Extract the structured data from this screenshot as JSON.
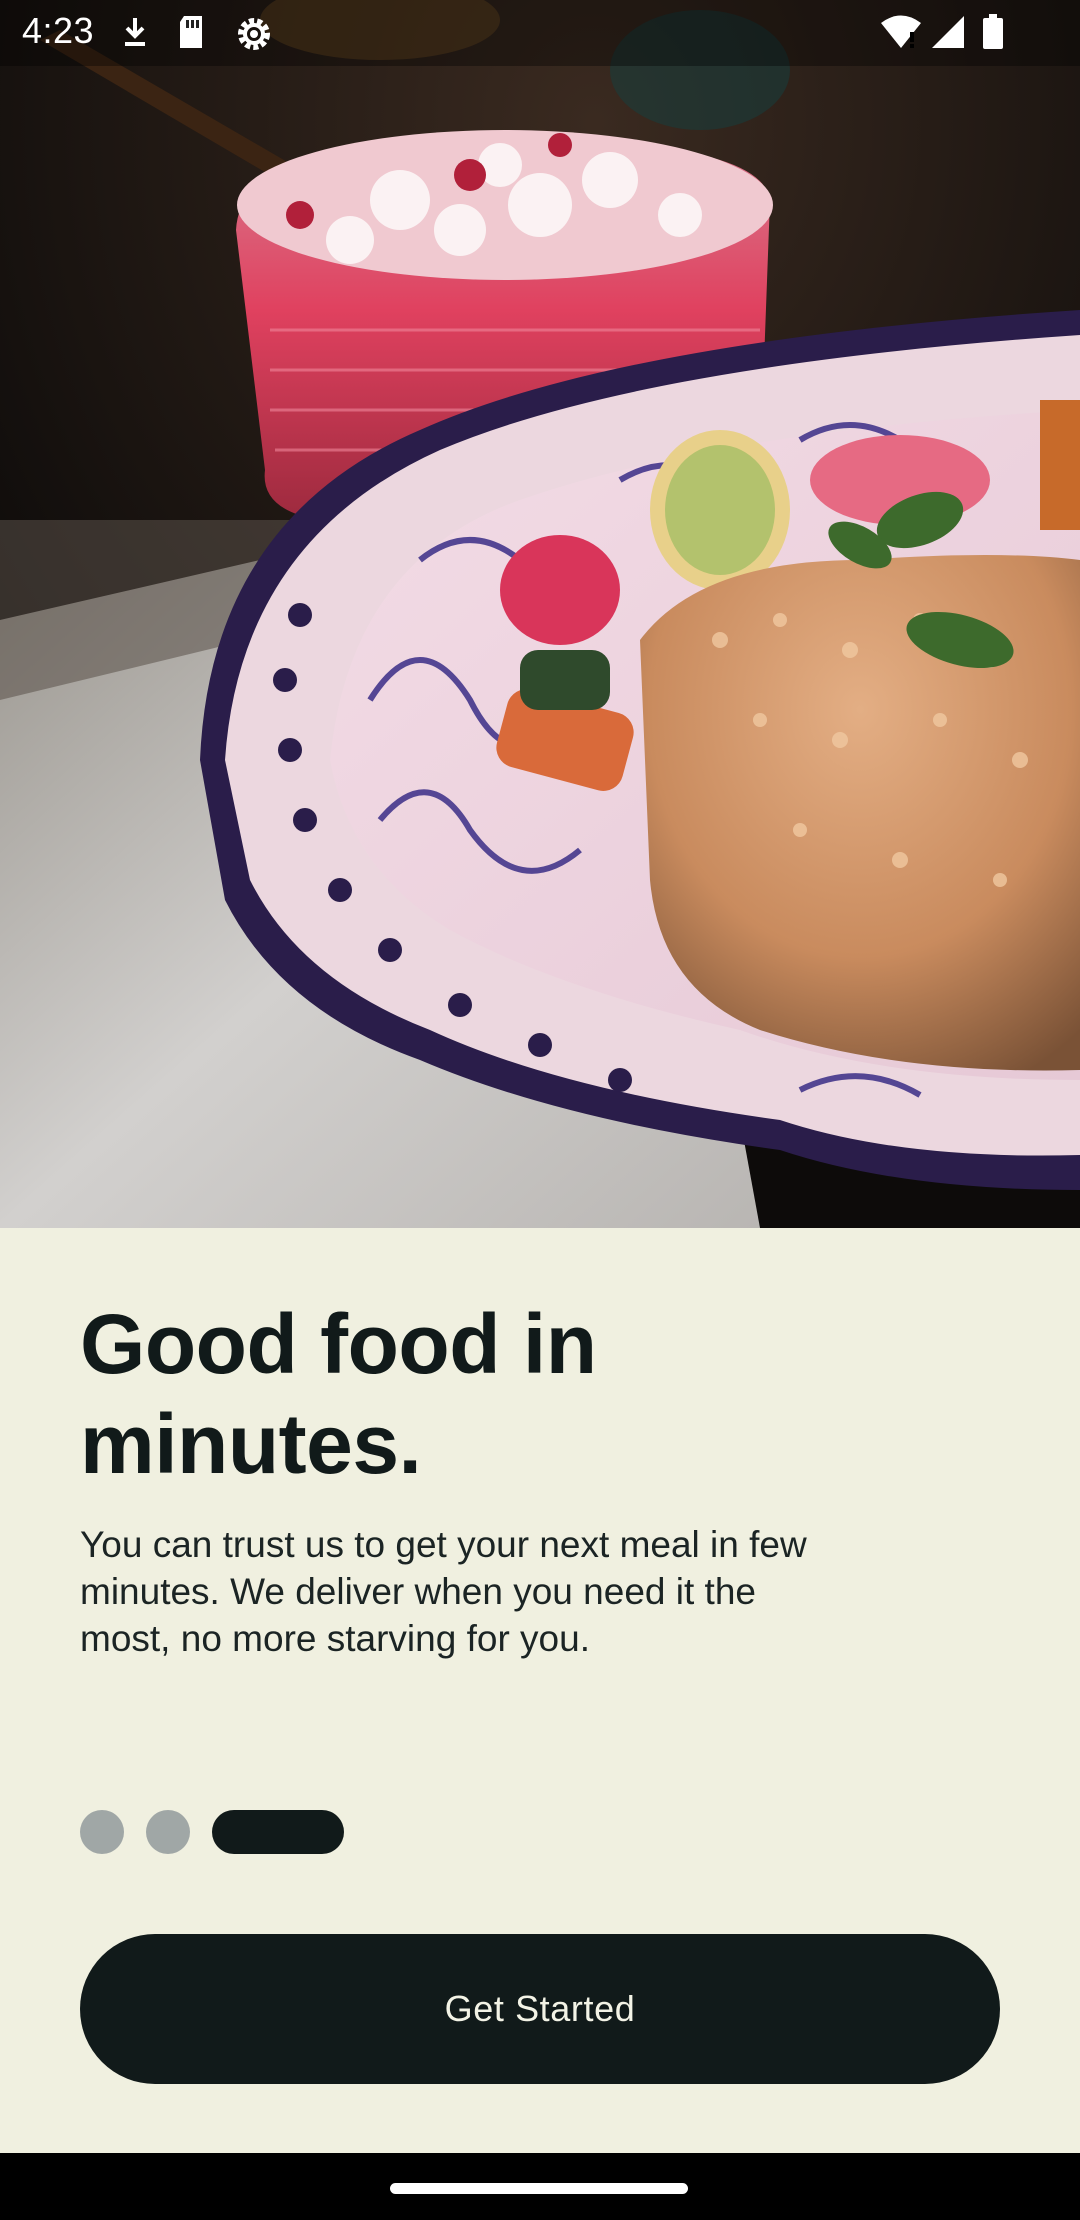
{
  "status_bar": {
    "time": "4:23",
    "left_icons": [
      "download-icon",
      "sd-card-icon",
      "settings-gear-icon"
    ],
    "right_icons": [
      "wifi-icon",
      "cellular-signal-icon",
      "battery-icon"
    ]
  },
  "hero": {
    "image": "food-photo",
    "accent_colors": {
      "drink": "#e04a66",
      "bowl_rim": "#2a1d4a",
      "rice": "#d9a27a",
      "table": "#c8c6c4"
    }
  },
  "onboarding": {
    "headline": "Good food in minutes.",
    "description": "You can trust us to get your next meal in few minutes. We deliver when you need it the most, no more starving for you.",
    "pager": {
      "total_pages": 3,
      "current_page": 3
    },
    "cta_label": "Get Started"
  },
  "theme": {
    "background": "#f0f0e0",
    "primary": "#111a1a",
    "dot_inactive": "#a0a7a6",
    "button_text": "#f3f3e6"
  }
}
